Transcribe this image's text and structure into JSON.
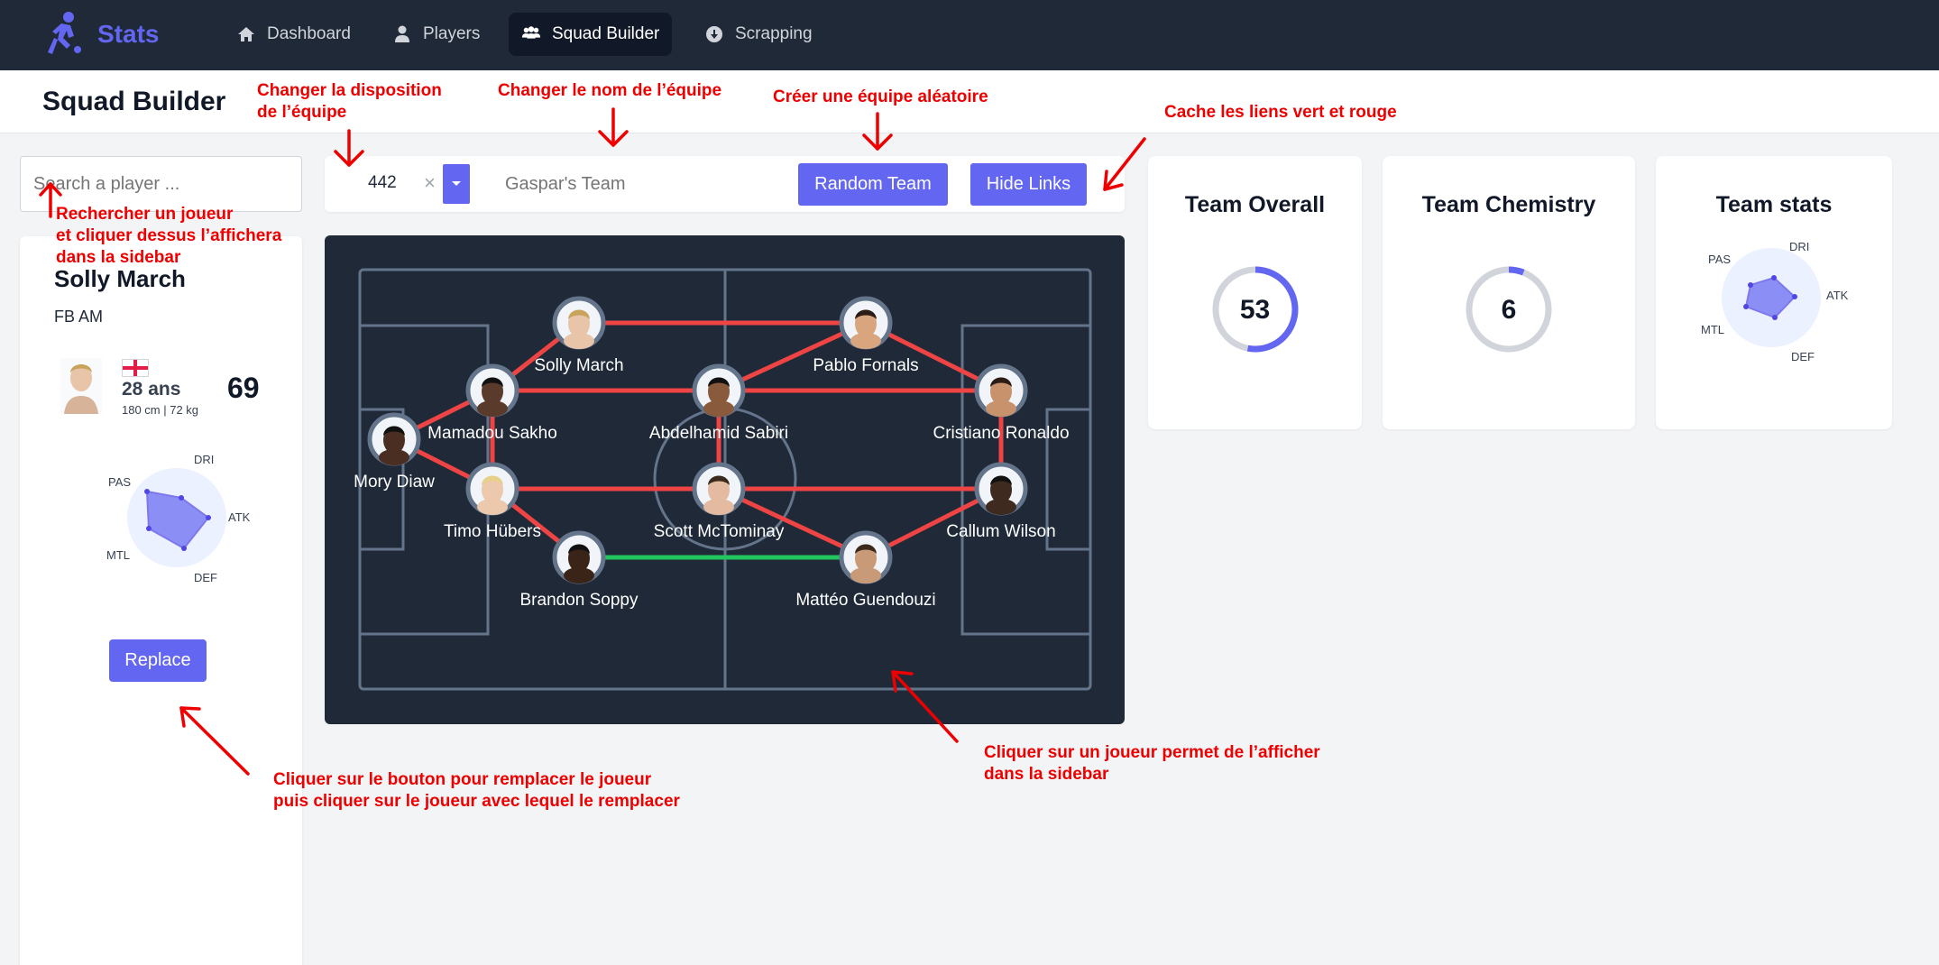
{
  "navbar": {
    "logo_text": "Stats",
    "items": [
      {
        "label": "Dashboard",
        "icon": "home-icon"
      },
      {
        "label": "Players",
        "icon": "user-icon"
      },
      {
        "label": "Squad Builder",
        "icon": "users-icon",
        "active": true
      },
      {
        "label": "Scrapping",
        "icon": "download-icon"
      }
    ]
  },
  "header": {
    "title": "Squad Builder"
  },
  "search": {
    "placeholder": "Search a player ..."
  },
  "sidebar": {
    "player_name": "Solly March",
    "positions": "FB AM",
    "age": "28 ans",
    "height_weight": "180 cm | 72 kg",
    "rating": "69",
    "radar_labels": [
      "DRI",
      "ATK",
      "DEF",
      "MTL",
      "PAS"
    ],
    "replace_label": "Replace"
  },
  "toolbar": {
    "formation": "442",
    "clear_symbol": "×",
    "team_name_placeholder": "Gaspar's Team",
    "random_label": "Random Team",
    "hide_links_label": "Hide Links"
  },
  "players": [
    {
      "name": "Solly March"
    },
    {
      "name": "Pablo Fornals"
    },
    {
      "name": "Mamadou Sakho"
    },
    {
      "name": "Abdelhamid Sabiri"
    },
    {
      "name": "Cristiano Ronaldo"
    },
    {
      "name": "Mory Diaw"
    },
    {
      "name": "Timo Hübers"
    },
    {
      "name": "Scott McTominay"
    },
    {
      "name": "Callum Wilson"
    },
    {
      "name": "Brandon Soppy"
    },
    {
      "name": "Mattéo Guendouzi"
    }
  ],
  "stats": {
    "overall_title": "Team Overall",
    "overall_value": "53",
    "overall_fraction": 0.53,
    "chemistry_title": "Team Chemistry",
    "chemistry_value": "6",
    "chemistry_fraction": 0.06,
    "teamstats_title": "Team stats",
    "radar_labels": [
      "DRI",
      "ATK",
      "DEF",
      "MTL",
      "PAS"
    ]
  },
  "annotations": {
    "formation": "Changer la disposition\nde l’équipe",
    "team_name": "Changer le nom de l’équipe",
    "random": "Créer une équipe aléatoire",
    "hide_links": "Cache les liens vert et rouge",
    "search": "Rechercher un joueur\net cliquer dessus l’affichera\ndans la sidebar",
    "replace": "Cliquer sur le bouton pour remplacer le joueur\npuis cliquer sur le joueur avec lequel le remplacer",
    "click_player": "Cliquer sur un joueur permet de l’afficher\ndans la sidebar"
  },
  "colors": {
    "accent": "#6366f1",
    "navbar": "#1f2937",
    "link_red": "#ef4444",
    "link_green": "#22c55e",
    "annotation": "#ef0000"
  }
}
